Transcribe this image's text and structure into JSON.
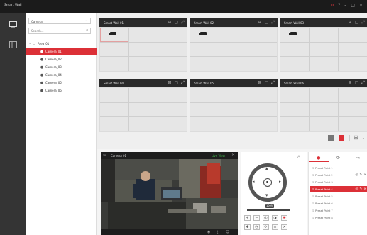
{
  "app": {
    "title": "Smart Wall",
    "icons": [
      "monitor-icon",
      "help-icon",
      "minimize-icon",
      "maximize-icon",
      "close-icon"
    ]
  },
  "tree": {
    "dropdown_value": "Camera",
    "search_placeholder": "Search...",
    "area_label": "Area_01",
    "cameras": [
      "Camera_01",
      "Camera_02",
      "Camera_03",
      "Camera_04",
      "Camera_05",
      "Camera_06"
    ],
    "selected_camera": "Camera_01"
  },
  "walls": [
    {
      "name": "Smart Wall 01"
    },
    {
      "name": "Smart Wall 02"
    },
    {
      "name": "Smart Wall 03"
    },
    {
      "name": "Smart Wall 04"
    },
    {
      "name": "Smart Wall 05"
    },
    {
      "name": "Smart Wall 06"
    }
  ],
  "preview": {
    "camera_name": "Camera 01",
    "live_label": "Live View"
  },
  "ptz": {
    "speed": "100%"
  },
  "presets": {
    "items": [
      "Preset Point 1",
      "Preset Point 2",
      "Preset Point 3",
      "Preset Point 4",
      "Preset Point 5",
      "Preset Point 6",
      "Preset Point 7",
      "Preset Point 8"
    ],
    "active_index": 3
  },
  "colors": {
    "accent": "#dc3037",
    "titlebar": "#1b1b1b",
    "nav": "#343434"
  }
}
